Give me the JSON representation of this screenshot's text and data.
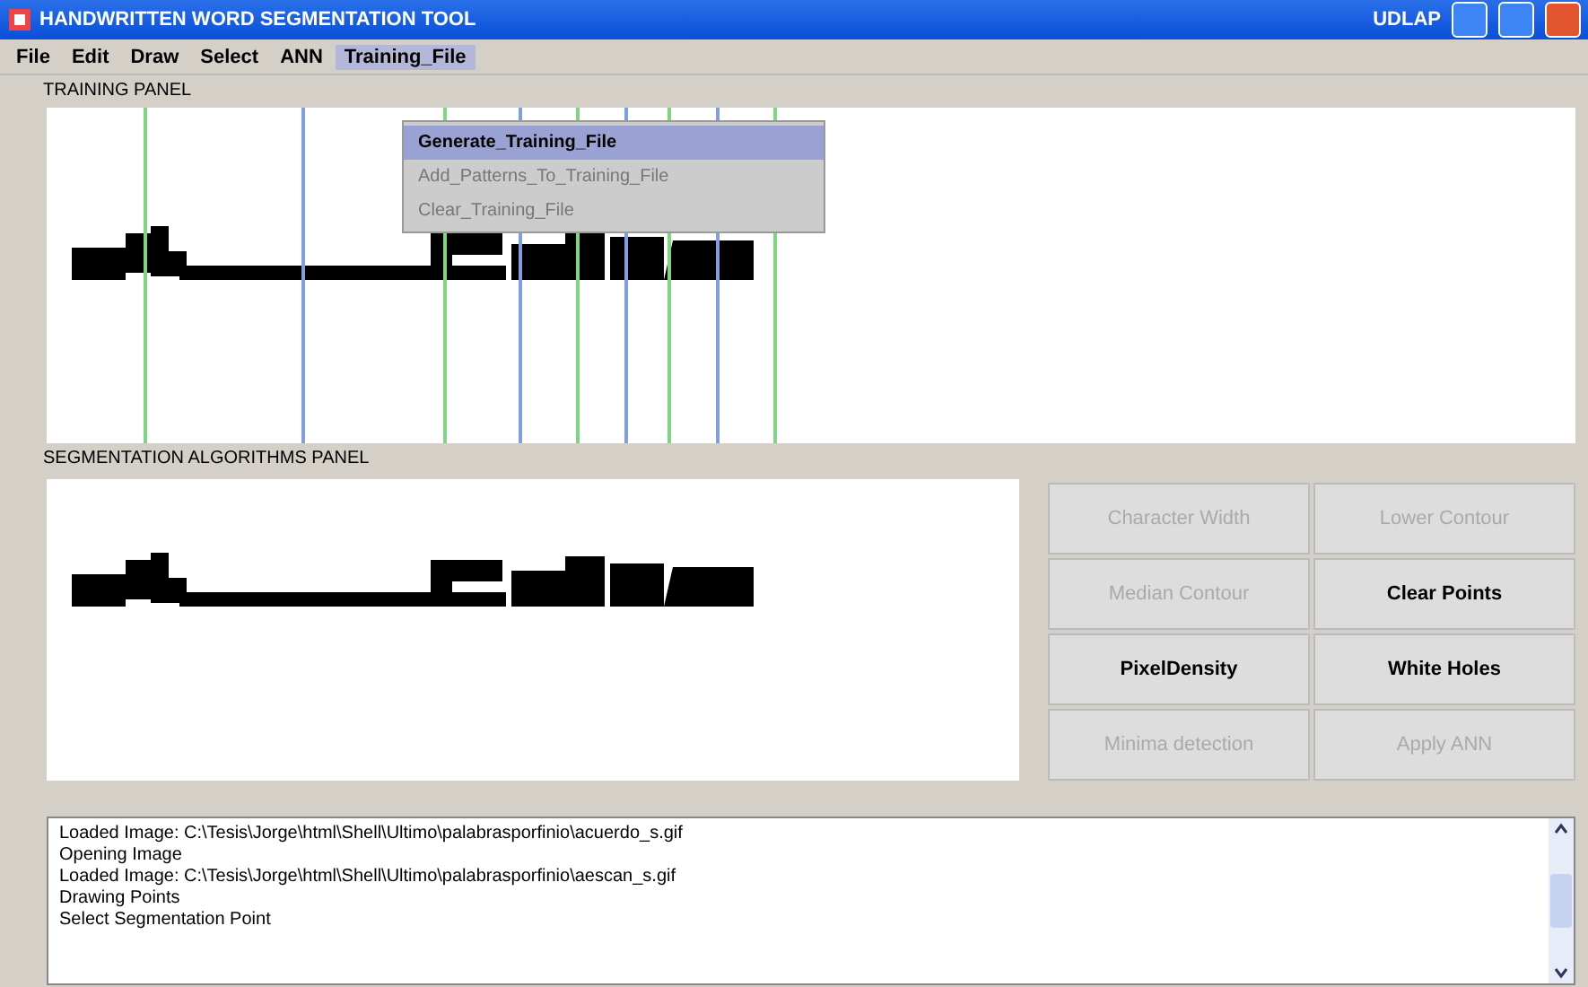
{
  "window": {
    "title": "HANDWRITTEN WORD SEGMENTATION TOOL",
    "tag": "UDLAP"
  },
  "menu_bar": [
    {
      "label": "File",
      "selected": false
    },
    {
      "label": "Edit",
      "selected": false
    },
    {
      "label": "Draw",
      "selected": false
    },
    {
      "label": "Select",
      "selected": false
    },
    {
      "label": "ANN",
      "selected": false
    },
    {
      "label": "Training_File",
      "selected": true
    }
  ],
  "dropdown": [
    {
      "label": "Generate_Training_File",
      "selected": true,
      "disabled": false
    },
    {
      "label": "Add_Patterns_To_Training_File",
      "selected": false,
      "disabled": true
    },
    {
      "label": "Clear_Training_File",
      "selected": false,
      "disabled": true
    }
  ],
  "training_panel": {
    "title": "TRAINING PANEL",
    "segment_lines": [
      {
        "color": "#7fd67f"
      },
      {
        "color": "#7f9fe0"
      },
      {
        "color": "#7fd67f"
      },
      {
        "color": "#7f9fe0"
      },
      {
        "color": "#7fd67f"
      },
      {
        "color": "#7f9fe0"
      },
      {
        "color": "#7fd67f"
      },
      {
        "color": "#7f9fe0"
      },
      {
        "color": "#7fd67f"
      }
    ]
  },
  "segmentation_panel": {
    "title": "SEGMENTATION ALGORITHMS PANEL"
  },
  "buttons": [
    {
      "label": "Character Width",
      "disabled": true
    },
    {
      "label": "Lower Contour",
      "disabled": true
    },
    {
      "label": "Median Contour",
      "disabled": true
    },
    {
      "label": "Clear Points",
      "disabled": false
    },
    {
      "label": "PixelDensity",
      "disabled": false
    },
    {
      "label": "White Holes",
      "disabled": false
    },
    {
      "label": "Minima detection",
      "disabled": true
    },
    {
      "label": "Apply ANN",
      "disabled": true
    }
  ],
  "log": [
    "Loaded Image: C:\\Tesis\\Jorge\\html\\Shell\\Ultimo\\palabrasporfinio\\acuerdo_s.gif",
    "Opening Image",
    "Loaded Image: C:\\Tesis\\Jorge\\html\\Shell\\Ultimo\\palabrasporfinio\\aescan_s.gif",
    "Drawing Points",
    "Select Segmentation Point"
  ]
}
